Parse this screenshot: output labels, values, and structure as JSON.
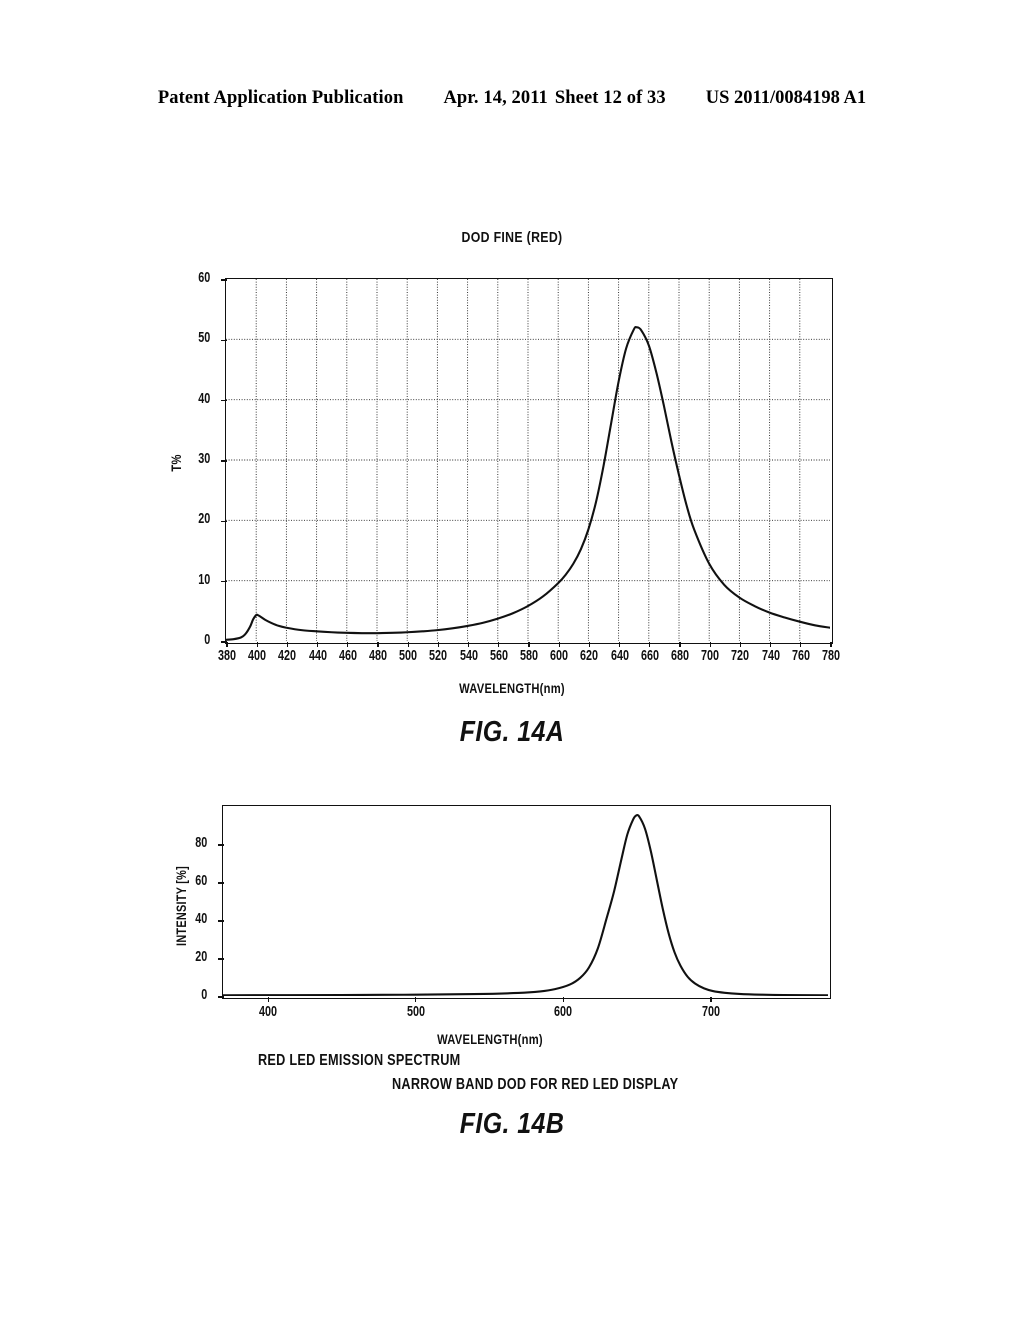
{
  "header": {
    "publication": "Patent Application Publication",
    "date": "Apr. 14, 2011",
    "sheet": "Sheet 12 of 33",
    "number": "US 2011/0084198 A1"
  },
  "figures": [
    {
      "id": "fig-14a",
      "caption": "FIG. 14A",
      "chart_data": {
        "type": "line",
        "title": "DOD FINE (RED)",
        "xlabel": "WAVELENGTH(nm)",
        "ylabel": "T%",
        "xlim": [
          380,
          780
        ],
        "ylim": [
          0,
          60
        ],
        "xticks": [
          380,
          400,
          420,
          440,
          460,
          480,
          500,
          520,
          540,
          560,
          580,
          600,
          620,
          640,
          660,
          680,
          700,
          720,
          740,
          760,
          780
        ],
        "yticks": [
          0,
          10,
          20,
          30,
          40,
          50,
          60
        ],
        "grid": true,
        "legend": "none",
        "series": [
          {
            "name": "DOD FINE (RED) transmittance",
            "x": [
              380,
              385,
              390,
              393,
              396,
              398,
              400,
              401,
              403,
              406,
              410,
              415,
              420,
              430,
              440,
              450,
              460,
              470,
              480,
              490,
              500,
              510,
              520,
              530,
              540,
              550,
              560,
              570,
              580,
              590,
              600,
              605,
              610,
              615,
              620,
              625,
              630,
              635,
              640,
              645,
              650,
              652,
              655,
              660,
              665,
              670,
              675,
              680,
              685,
              690,
              700,
              710,
              720,
              730,
              740,
              750,
              760,
              770,
              780
            ],
            "y": [
              0.2,
              0.3,
              0.6,
              1.2,
              2.4,
              3.6,
              4.3,
              4.3,
              4.0,
              3.5,
              3.0,
              2.5,
              2.2,
              1.8,
              1.6,
              1.45,
              1.35,
              1.3,
              1.3,
              1.35,
              1.45,
              1.6,
              1.8,
              2.1,
              2.5,
              3.0,
              3.7,
              4.6,
              5.8,
              7.4,
              9.6,
              11.0,
              12.8,
              15.2,
              18.5,
              23.0,
              29.0,
              36.0,
              43.0,
              48.5,
              51.6,
              52.0,
              51.5,
              49.0,
              44.5,
              39.0,
              33.0,
              27.5,
              22.5,
              18.5,
              12.8,
              9.3,
              7.2,
              5.8,
              4.7,
              3.9,
              3.2,
              2.6,
              2.2
            ]
          }
        ]
      }
    },
    {
      "id": "fig-14b",
      "caption": "FIG. 14B",
      "notes": [
        "RED LED EMISSION SPECTRUM",
        "NARROW BAND DOD FOR RED LED DISPLAY"
      ],
      "chart_data": {
        "type": "line",
        "title": "",
        "xlabel": "WAVELENGTH(nm)",
        "ylabel": "INTENSITY [%]",
        "xlim": [
          370,
          780
        ],
        "ylim": [
          0,
          100
        ],
        "xticks": [
          400,
          500,
          600,
          700
        ],
        "yticks": [
          0,
          20,
          40,
          60,
          80
        ],
        "grid": false,
        "legend": "none",
        "series": [
          {
            "name": "RED LED emission spectrum",
            "x": [
              370,
              450,
              500,
              540,
              570,
              585,
              595,
              605,
              612,
              618,
              624,
              630,
              635,
              640,
              644,
              648,
              650,
              652,
              656,
              660,
              664,
              668,
              672,
              676,
              680,
              685,
              690,
              696,
              702,
              710,
              720,
              735,
              750,
              780
            ],
            "y": [
              0.4,
              0.5,
              0.7,
              1.0,
              1.6,
              2.4,
              3.6,
              6.0,
              9.5,
              15.0,
              25.0,
              41.0,
              55.0,
              72.0,
              85.0,
              93.0,
              95.0,
              94.5,
              88.0,
              76.0,
              61.0,
              46.0,
              33.0,
              23.0,
              16.0,
              10.0,
              6.5,
              4.0,
              2.6,
              1.7,
              1.1,
              0.7,
              0.5,
              0.4
            ]
          }
        ]
      }
    }
  ]
}
